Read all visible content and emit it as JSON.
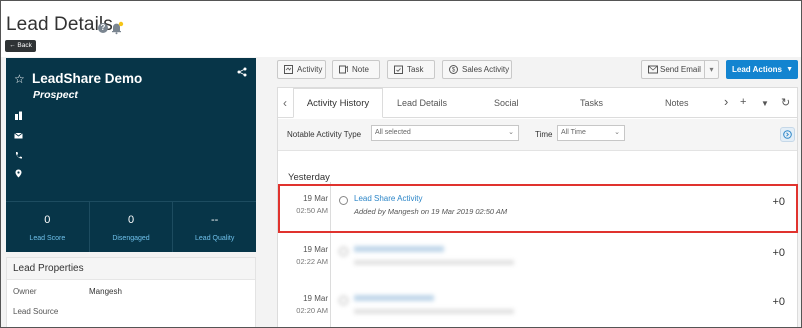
{
  "header": {
    "title": "Lead Details",
    "back_label": "Back"
  },
  "lead": {
    "name": "LeadShare Demo",
    "stage": "Prospect",
    "metrics": [
      {
        "value": "0",
        "label": "Lead Score"
      },
      {
        "value": "0",
        "label": "Disengaged"
      },
      {
        "value": "--",
        "label": "Lead Quality"
      }
    ]
  },
  "properties": {
    "title": "Lead Properties",
    "rows": [
      {
        "label": "Owner",
        "value": "Mangesh"
      },
      {
        "label": "Lead Source",
        "value": ""
      }
    ]
  },
  "toolbar": {
    "activity": "Activity",
    "note": "Note",
    "task": "Task",
    "sales_activity": "Sales Activity",
    "send_email": "Send Email",
    "lead_actions": "Lead Actions"
  },
  "tabs": [
    "Activity History",
    "Lead Details",
    "Social",
    "Tasks",
    "Notes"
  ],
  "filters": {
    "type_label": "Notable Activity Type",
    "type_value": "All selected",
    "time_label": "Time",
    "time_value": "All Time"
  },
  "timeline": {
    "day": "Yesterday",
    "activities": [
      {
        "date": "19 Mar",
        "time": "02:50 AM",
        "title": "Lead Share Activity",
        "subtitle": "Added by Mangesh on 19 Mar 2019 02:50 AM",
        "score": "+0"
      },
      {
        "date": "19 Mar",
        "time": "02:22 AM",
        "title": "",
        "subtitle": "",
        "score": "+0"
      },
      {
        "date": "19 Mar",
        "time": "02:20 AM",
        "title": "",
        "subtitle": "",
        "score": "+0"
      }
    ]
  },
  "colors": {
    "card_bg": "#073548",
    "primary": "#1384d0",
    "highlight": "#e0332e",
    "link": "#2c86c8"
  }
}
